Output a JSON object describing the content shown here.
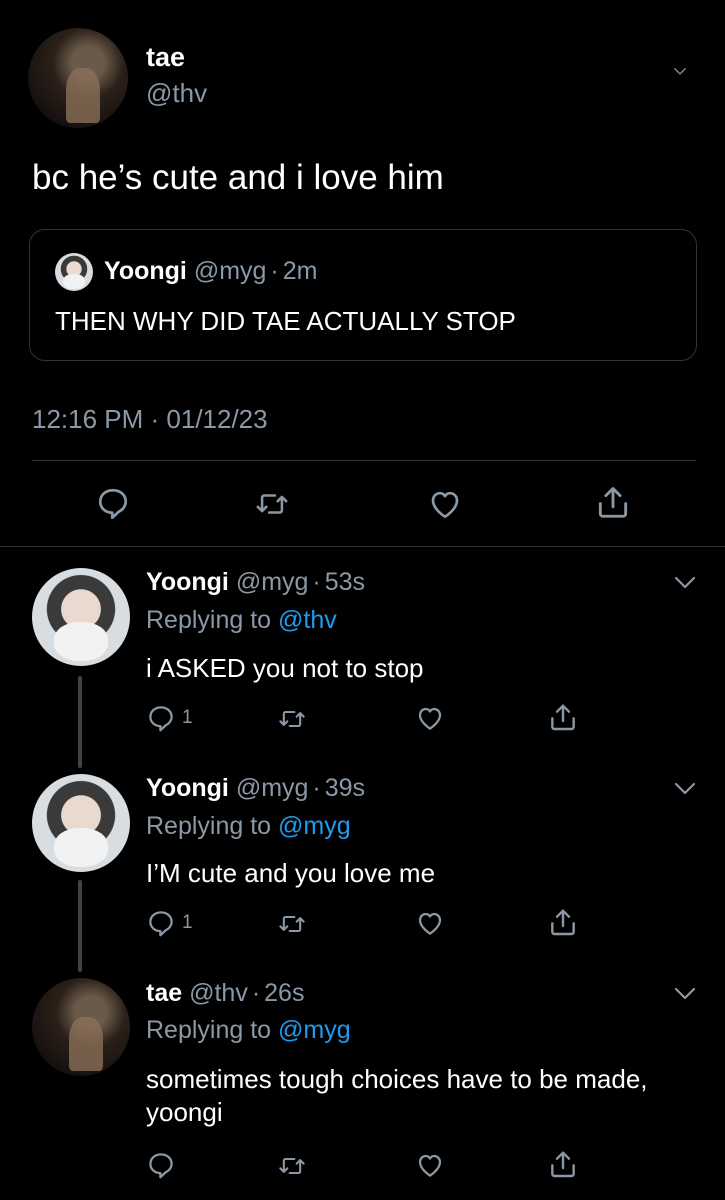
{
  "main_tweet": {
    "author_name": "tae",
    "author_handle": "@thv",
    "text": "bc he’s cute and i love him",
    "quote": {
      "author_name": "Yoongi",
      "author_handle": "@myg",
      "dot": "·",
      "time": "2m",
      "text": "THEN WHY DID TAE ACTUALLY STOP"
    },
    "timestamp": "12:16 PM · 01/12/23"
  },
  "replies": [
    {
      "author_name": "Yoongi",
      "author_handle": "@myg",
      "dot": "·",
      "time": "53s",
      "replying_prefix": "Replying to",
      "replying_to": "@thv",
      "text": "i ASKED you not to stop",
      "reply_count": "1"
    },
    {
      "author_name": "Yoongi",
      "author_handle": "@myg",
      "dot": "·",
      "time": "39s",
      "replying_prefix": "Replying to",
      "replying_to": "@myg",
      "text": "I’M cute and you love me",
      "reply_count": "1"
    },
    {
      "author_name": "tae",
      "author_handle": "@thv",
      "dot": "·",
      "time": "26s",
      "replying_prefix": "Replying to",
      "replying_to": "@myg",
      "text": "sometimes tough choices have to be made, yoongi",
      "reply_count": ""
    }
  ],
  "icons": [
    "chevron-down-icon",
    "reply-icon",
    "retweet-icon",
    "like-icon",
    "share-icon"
  ],
  "colors": {
    "background": "#000000",
    "text": "#ffffff",
    "muted": "#8b98a5",
    "link": "#1d9bf0",
    "divider": "#2f3336"
  }
}
